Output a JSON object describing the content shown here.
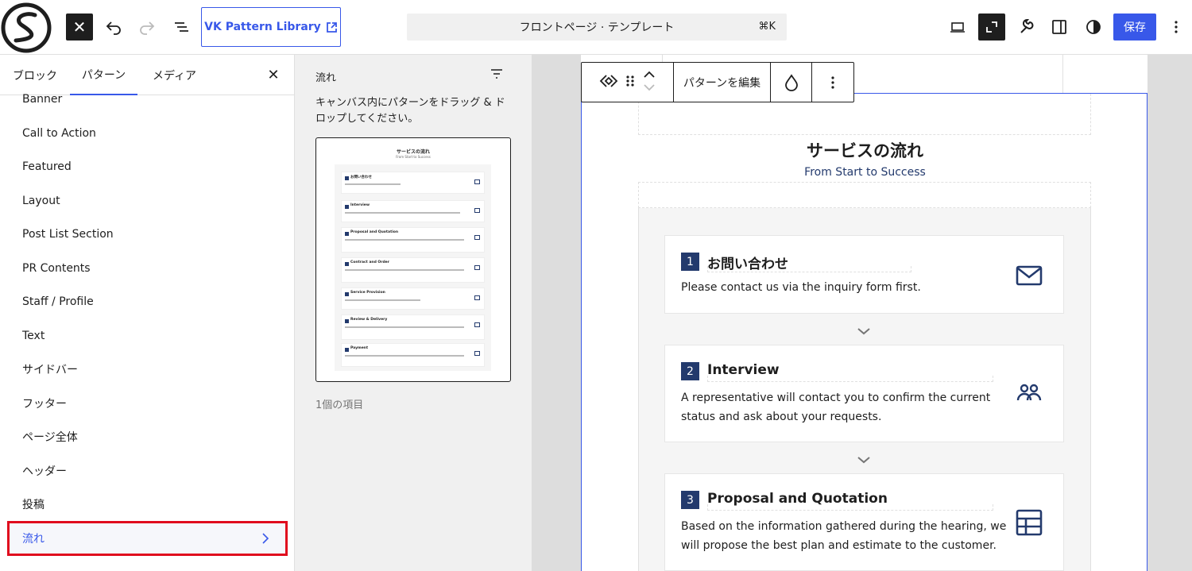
{
  "topbar": {
    "vk_button_label": "VK Pattern Library",
    "command_bar_text": "フロントページ · テンプレート",
    "command_shortcut": "⌘K",
    "save_label": "保存"
  },
  "sidebar": {
    "tabs": [
      "ブロック",
      "パターン",
      "メディア"
    ],
    "active_tab": "パターン",
    "categories": [
      "Banner",
      "Call to Action",
      "Featured",
      "Layout",
      "Post List Section",
      "PR Contents",
      "Staff / Profile",
      "Text",
      "サイドバー",
      "フッター",
      "ページ全体",
      "ヘッダー",
      "投稿",
      "流れ"
    ],
    "selected_category": "流れ"
  },
  "pattern_panel": {
    "title": "流れ",
    "description": "キャンバス内にパターンをドラッグ & ドロップしてください。",
    "count_text": "1個の項目",
    "thumbnail": {
      "title": "サービスの流れ",
      "subtitle": "From Start to Success",
      "steps": [
        "お問い合わせ",
        "Interview",
        "Proposal and Quotation",
        "Contract and Order",
        "Service Provision",
        "Review & Delivery",
        "Payment"
      ]
    }
  },
  "block_toolbar": {
    "edit_pattern_label": "パターンを編集"
  },
  "canvas": {
    "section_title": "サービスの流れ",
    "section_subtitle": "From Start to Success",
    "steps": [
      {
        "number": "1",
        "title": "お問い合わせ",
        "text_lines": [
          "Please contact us via the inquiry form first."
        ],
        "icon": "envelope-icon"
      },
      {
        "number": "2",
        "title": "Interview",
        "text_lines": [
          "A representative will contact you to confirm the current",
          "status and ask about your requests."
        ],
        "icon": "users-icon"
      },
      {
        "number": "3",
        "title": "Proposal and Quotation",
        "text_lines": [
          "Based on the information gathered during the hearing, we",
          "will propose the best plan and estimate to the customer."
        ],
        "icon": "table-icon"
      }
    ]
  },
  "colors": {
    "accent": "#3858e9",
    "navy": "#233a6d",
    "highlight_red": "#e00c1e"
  }
}
